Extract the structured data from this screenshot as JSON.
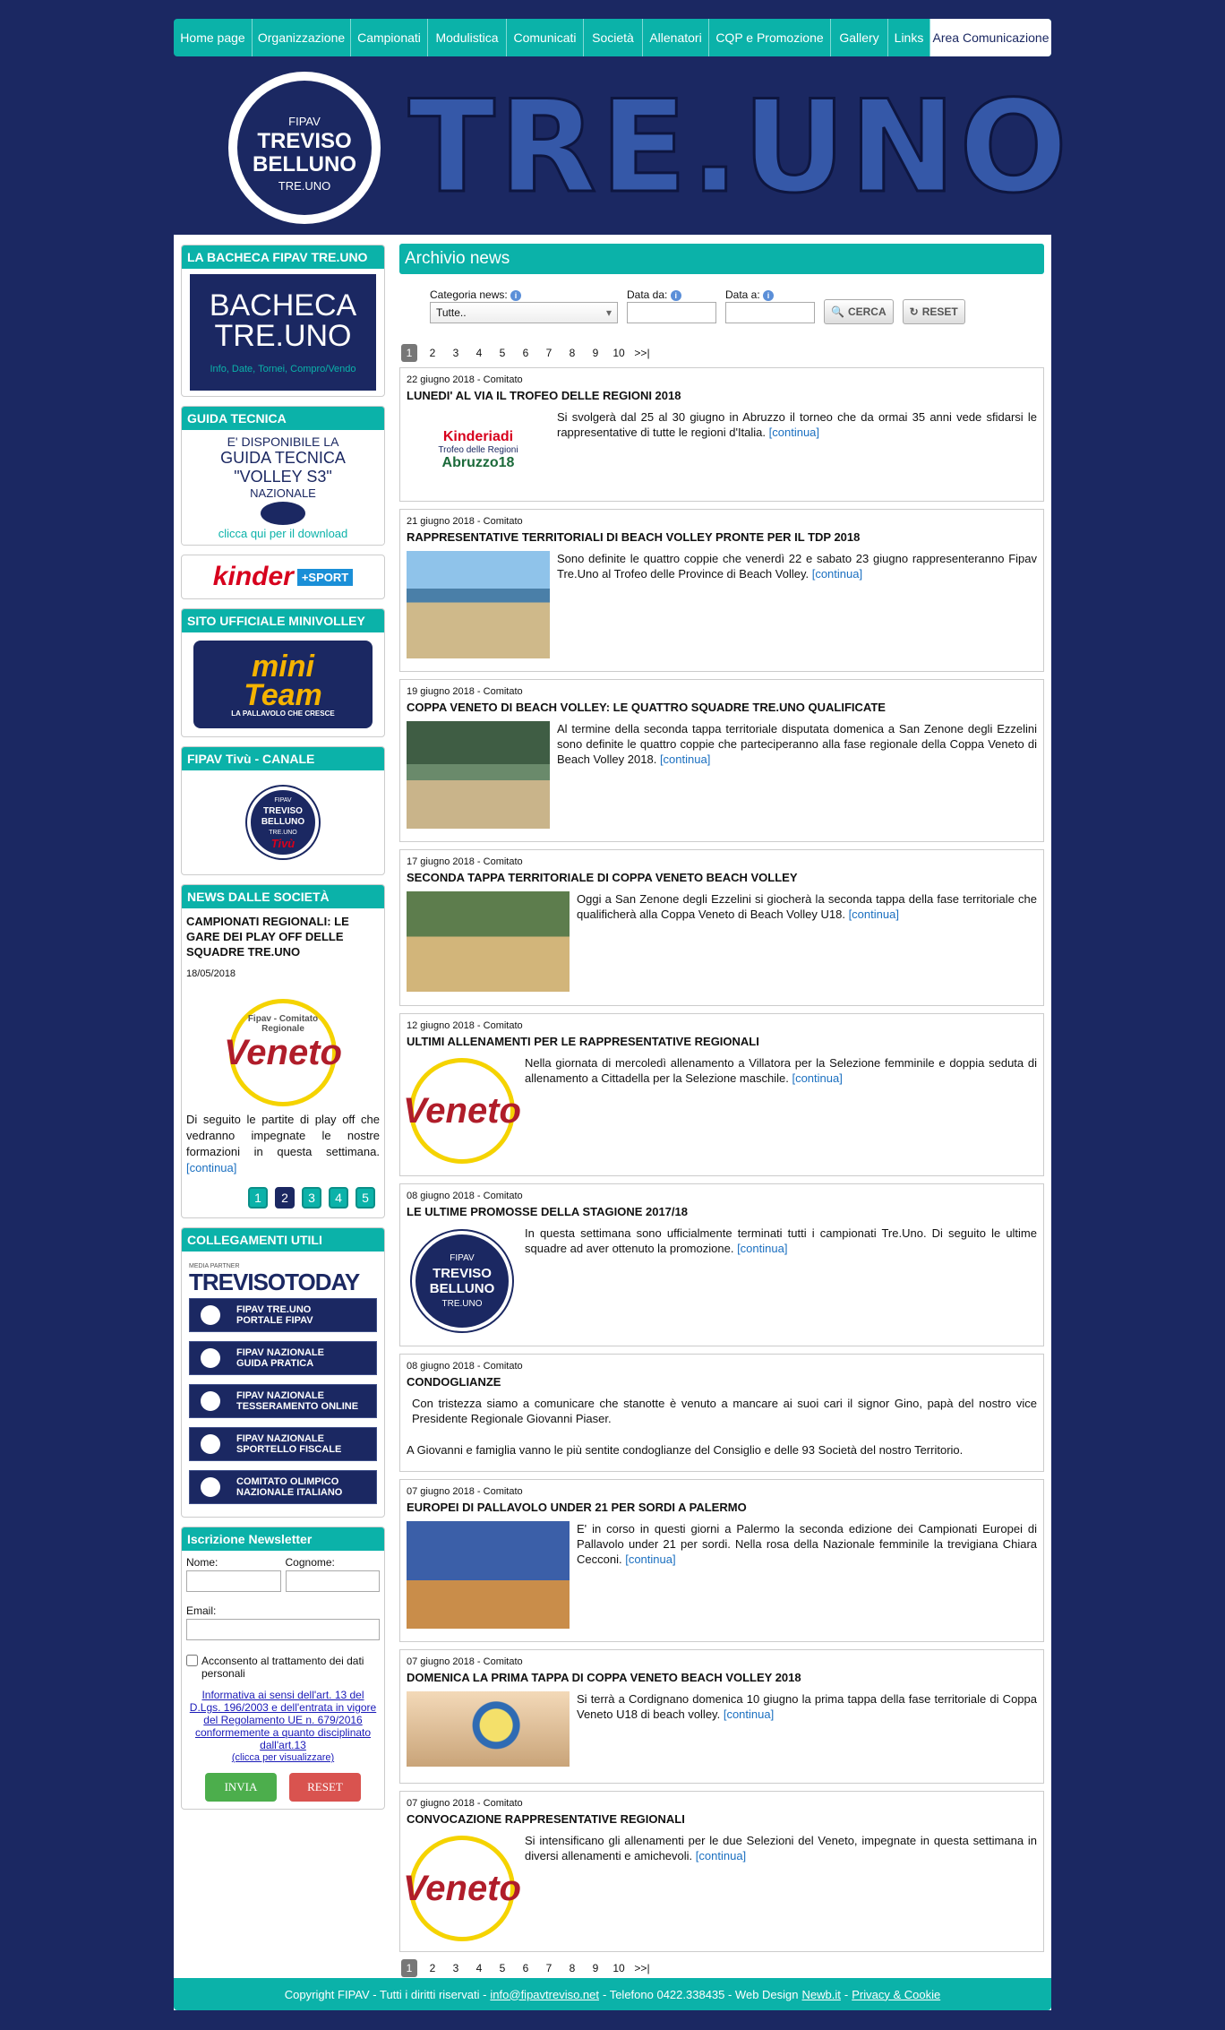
{
  "nav": [
    "Home page",
    "Organizzazione",
    "Campionati",
    "Modulistica",
    "Comunicati",
    "Società",
    "Allenatori",
    "CQP e Promozione",
    "Gallery",
    "Links",
    "Area Comunicazione"
  ],
  "header": {
    "logo_l1": "FIPAV",
    "logo_l2": "TREVISO",
    "logo_l3": "BELLUNO",
    "logo_l4": "TRE.UNO",
    "title": "TRE.UNO"
  },
  "sidebar": {
    "bacheca_title": "LA BACHECA FIPAV TRE.UNO",
    "bacheca_l1": "BACHECA",
    "bacheca_l2": "TRE.UNO",
    "bacheca_l3": "Info, Date, Tornei, Compro/Vendo",
    "guida_title": "GUIDA TECNICA",
    "guida_l1": "E' DISPONIBILE LA",
    "guida_l2": "GUIDA TECNICA",
    "guida_l3": "\"VOLLEY S3\"",
    "guida_l4": "NAZIONALE",
    "guida_l5": "clicca qui per il download",
    "kinder": "kinder",
    "kinder_sport": "+SPORT",
    "mini_title": "SITO UFFICIALE MINIVOLLEY",
    "mini_l1": "mini",
    "mini_l2": "Team",
    "mini_l3": "LA PALLAVOLO CHE CRESCE",
    "tivu_title": "FIPAV Tivù - CANALE YOUTUBE",
    "tivu_logo_l1": "FIPAV",
    "tivu_logo_l2": "TREVISO",
    "tivu_logo_l3": "BELLUNO",
    "tivu_logo_l4": "TRE.UNO",
    "tivu_logo_l5": "Tivù",
    "news_title": "NEWS DALLE SOCIETÀ",
    "news_item_title": "CAMPIONATI REGIONALI: LE GARE DEI PLAY OFF DELLE SQUADRE TRE.UNO",
    "news_item_date": "18/05/2018",
    "news_item_logo_ring": "Fipav - Comitato Regionale",
    "news_item_logo": "Veneto",
    "news_item_text": "Di seguito le partite di play off che vedranno impegnate le nostre formazioni in questa settimana.",
    "continua": "[continua]",
    "news_pages": [
      "1",
      "2",
      "3",
      "4",
      "5"
    ],
    "links_title": "COLLEGAMENTI UTILI",
    "trev_small": "MEDIA PARTNER",
    "trev_big": "TREVISOTODAY",
    "links": [
      [
        "FIPAV TRE.UNO",
        "PORTALE FIPAV"
      ],
      [
        "FIPAV NAZIONALE",
        "GUIDA PRATICA"
      ],
      [
        "FIPAV NAZIONALE",
        "TESSERAMENTO ONLINE"
      ],
      [
        "FIPAV NAZIONALE",
        "SPORTELLO FISCALE"
      ],
      [
        "COMITATO OLIMPICO",
        "NAZIONALE ITALIANO"
      ]
    ],
    "nl_title": "Iscrizione Newsletter",
    "nl_nome": "Nome:",
    "nl_cognome": "Cognome:",
    "nl_email": "Email:",
    "nl_consent": "Acconsento al trattamento dei dati personali",
    "nl_info": "Informativa ai sensi dell'art. 13 del D.Lgs. 196/2003 e dell'entrata in vigore del Regolamento UE n. 679/2016 conformemente a quanto disciplinato dall'art.13",
    "nl_click": "(clicca per visualizzare)",
    "nl_invia": "INVIA",
    "nl_reset": "RESET"
  },
  "content": {
    "title": "Archivio news",
    "cat_label": "Categoria news:",
    "cat_value": "Tutte..",
    "da_label": "Data da:",
    "a_label": "Data a:",
    "cerca": "CERCA",
    "reset": "RESET",
    "pages": [
      "1",
      "2",
      "3",
      "4",
      "5",
      "6",
      "7",
      "8",
      "9",
      "10",
      ">>|"
    ],
    "continua": "[continua]",
    "news": [
      {
        "date": "22 giugno 2018 - Comitato",
        "title": "LUNEDI' AL VIA IL TROFEO DELLE REGIONI 2018",
        "text": "Si svolgerà dal 25 al 30 giugno in Abruzzo il torneo che da ormai 35 anni vede sfidarsi le rappresentative di tutte le regioni d'Italia.",
        "img": "Kinderiadi Trofeo delle Regioni Abruzzo18"
      },
      {
        "date": "21 giugno 2018 - Comitato",
        "title": "RAPPRESENTATIVE TERRITORIALI DI BEACH VOLLEY PRONTE PER IL TDP 2018",
        "text": "Sono definite le quattro coppie che venerdì 22 e sabato 23 giugno rappresenteranno Fipav Tre.Uno al Trofeo delle Province di Beach Volley.",
        "img": ""
      },
      {
        "date": "19 giugno 2018 - Comitato",
        "title": "COPPA VENETO DI BEACH VOLLEY: LE QUATTRO SQUADRE TRE.UNO QUALIFICATE",
        "text": "Al termine della seconda tappa territoriale disputata domenica a San Zenone degli Ezzelini sono definite le quattro coppie che parteciperanno alla fase regionale della Coppa Veneto di Beach Volley 2018.",
        "img": ""
      },
      {
        "date": "17 giugno 2018 - Comitato",
        "title": "SECONDA TAPPA TERRITORIALE DI COPPA VENETO BEACH VOLLEY",
        "text": "Oggi a San Zenone degli Ezzelini si giocherà la seconda tappa della fase territoriale che qualificherà alla Coppa Veneto di Beach Volley U18.",
        "img": ""
      },
      {
        "date": "12 giugno 2018 - Comitato",
        "title": "ULTIMI ALLENAMENTI PER LE RAPPRESENTATIVE REGIONALI",
        "text": "Nella giornata di mercoledì allenamento a Villatora per la Selezione femminile e doppia seduta di allenamento a Cittadella per la Selezione maschile.",
        "img": "Veneto"
      },
      {
        "date": "08 giugno 2018 - Comitato",
        "title": "LE ULTIME PROMOSSE DELLA STAGIONE 2017/18",
        "text": "In questa settimana sono ufficialmente terminati tutti i campionati Tre.Uno. Di seguito le ultime squadre ad aver ottenuto la promozione.",
        "img": "logo"
      },
      {
        "date": "08 giugno 2018 - Comitato",
        "title": "CONDOGLIANZE",
        "text": "Con tristezza siamo a comunicare che stanotte è venuto a mancare ai suoi cari il signor Gino, papà del nostro vice Presidente Regionale Giovanni Piaser.",
        "text2": "A Giovanni e famiglia vanno le più sentite condoglianze del Consiglio e delle 93 Società del nostro Territorio.",
        "img": "none"
      },
      {
        "date": "07 giugno 2018 - Comitato",
        "title": "EUROPEI DI PALLAVOLO UNDER 21 PER SORDI A PALERMO",
        "text": "E' in corso in questi giorni a Palermo la seconda edizione dei Campionati Europei di Pallavolo under 21 per sordi. Nella rosa della Nazionale femminile la trevigiana Chiara Cecconi.",
        "img": ""
      },
      {
        "date": "07 giugno 2018 - Comitato",
        "title": "DOMENICA LA PRIMA TAPPA DI COPPA VENETO BEACH VOLLEY 2018",
        "text": "Si terrà a Cordignano domenica 10 giugno la prima tappa della fase territoriale di Coppa Veneto U18 di beach volley.",
        "img": ""
      },
      {
        "date": "07 giugno 2018 - Comitato",
        "title": "CONVOCAZIONE RAPPRESENTATIVE REGIONALI",
        "text": "Si intensificano gli allenamenti per le due Selezioni del Veneto, impegnate in questa settimana in diversi allenamenti e amichevoli.",
        "img": "Veneto"
      }
    ]
  },
  "footer": {
    "copy": "Copyright FIPAV - Tutti i diritti riservati -",
    "email": "info@fipavtreviso.net",
    "tel": "- Telefono 0422.338435 - Web Design",
    "design": "Newb.it",
    "sep": "-",
    "privacy": "Privacy & Cookie"
  }
}
